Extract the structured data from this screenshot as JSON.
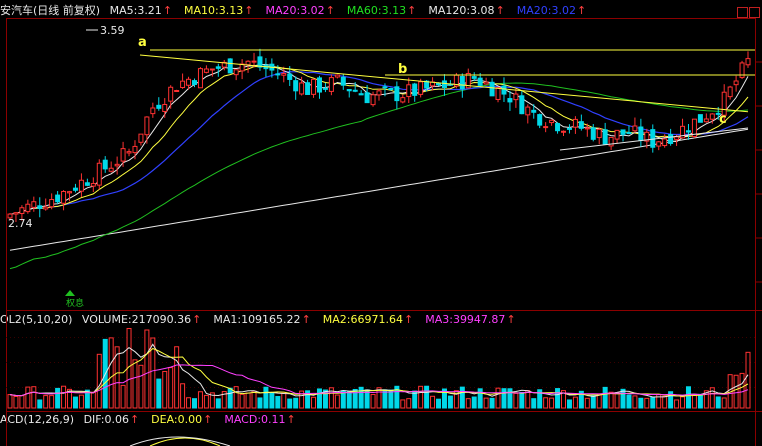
{
  "main_legend": {
    "title": "安汽车(日线 前复权)",
    "items": [
      {
        "label": "MA5:3.21",
        "color": "#e8e8e8"
      },
      {
        "label": "MA10:3.13",
        "color": "#ffff40"
      },
      {
        "label": "MA20:3.02",
        "color": "#ff40ff"
      },
      {
        "label": "MA60:3.13",
        "color": "#20e020"
      },
      {
        "label": "MA120:3.08",
        "color": "#e8e8e8"
      },
      {
        "label": "MA20:3.02",
        "color": "#3040ff"
      }
    ],
    "arrow": "↑"
  },
  "vol_legend": {
    "title": "OL2(5,10,20)",
    "items": [
      {
        "label": "VOLUME:217090.36",
        "color": "#e8e8e8"
      },
      {
        "label": "MA1:109165.22",
        "color": "#e8e8e8"
      },
      {
        "label": "MA2:66971.64",
        "color": "#ffff40"
      },
      {
        "label": "MA3:39947.87",
        "color": "#ff40ff"
      }
    ],
    "arrow": "↑"
  },
  "macd_legend": {
    "title": "ACD(12,26,9)",
    "items": [
      {
        "label": "DIF:0.06",
        "color": "#e8e8e8"
      },
      {
        "label": "DEA:0.00",
        "color": "#ffff40"
      },
      {
        "label": "MACD:0.11",
        "color": "#ff40ff"
      }
    ],
    "arrow": "↑"
  },
  "annotations": {
    "high_label": "3.59",
    "low_label": "2.74",
    "mark_a": "a",
    "mark_b": "b",
    "mark_c": "c",
    "event_label": "权息"
  },
  "chart_data": {
    "type": "candlestick",
    "title": "安汽车(日线 前复权)",
    "price_high": 3.59,
    "price_low": 2.74,
    "moving_averages": [
      {
        "name": "MA5",
        "value": 3.21
      },
      {
        "name": "MA10",
        "value": 3.13
      },
      {
        "name": "MA20",
        "value": 3.02
      },
      {
        "name": "MA60",
        "value": 3.13
      },
      {
        "name": "MA120",
        "value": 3.08
      }
    ],
    "volume": {
      "VOLUME": 217090.36,
      "MA1": 109165.22,
      "MA2": 66971.64,
      "MA3": 39947.87
    },
    "macd": {
      "DIF": 0.06,
      "DEA": 0.0,
      "MACD": 0.11
    },
    "trendline_points": [
      "a",
      "b",
      "c"
    ],
    "colors": {
      "up": "#ff3232",
      "down": "#00d8e8",
      "grid": "#8b0000",
      "background": "#000000"
    }
  }
}
